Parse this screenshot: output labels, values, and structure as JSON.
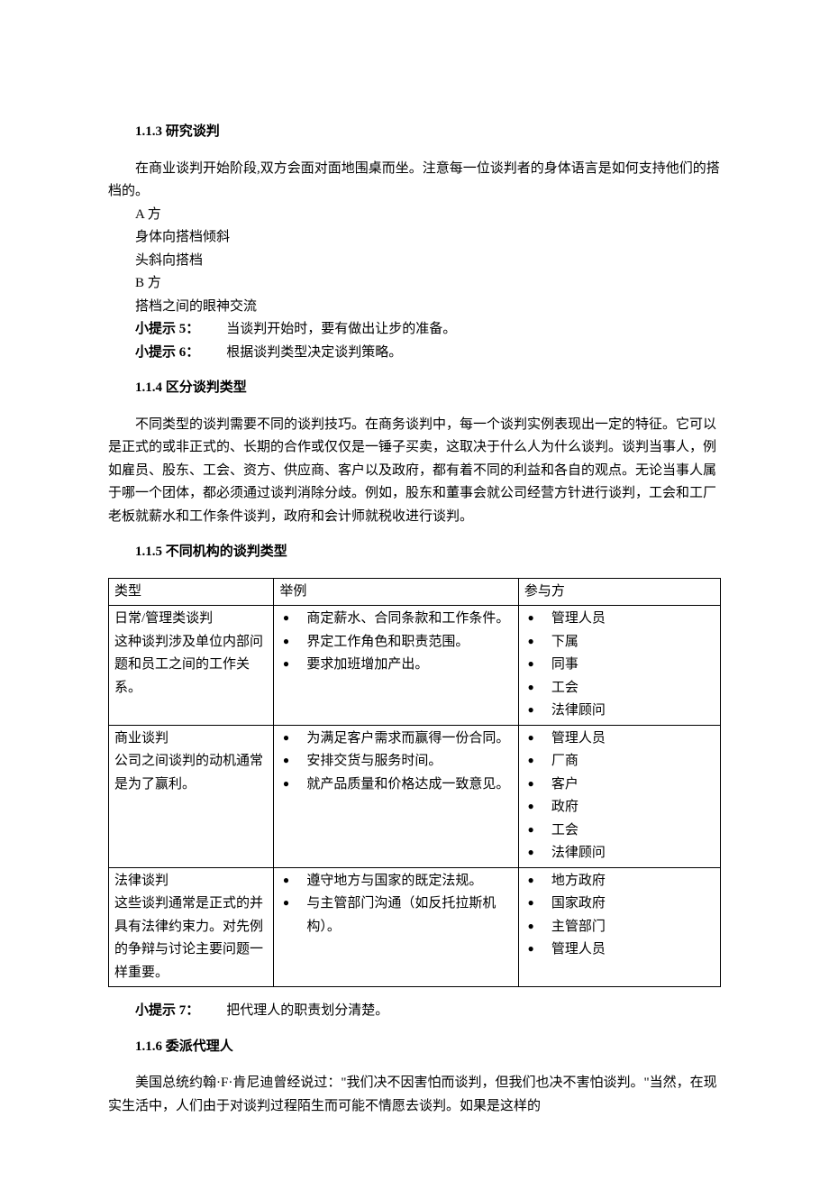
{
  "s113": {
    "heading": "1.1.3 研究谈判",
    "p1": "在商业谈判开始阶段,双方会面对面地围桌而坐。注意每一位谈判者的身体语言是如何支持他们的搭档的。",
    "lines": [
      "A 方",
      "身体向搭档倾斜",
      "头斜向搭档",
      "B 方",
      "搭档之间的眼神交流"
    ],
    "tip5_label": "小提示 5：",
    "tip5_text": "当谈判开始时，要有做出让步的准备。",
    "tip6_label": "小提示 6：",
    "tip6_text": "根据谈判类型决定谈判策略。"
  },
  "s114": {
    "heading": "1.1.4 区分谈判类型",
    "p1": "不同类型的谈判需要不同的谈判技巧。在商务谈判中，每一个谈判实例表现出一定的特征。它可以是正式的或非正式的、长期的合作或仅仅是一锤子买卖，这取决于什么人为什么谈判。谈判当事人，例如雇员、股东、工会、资方、供应商、客户以及政府，都有着不同的利益和各自的观点。无论当事人属于哪一个团体，都必须通过谈判消除分歧。例如，股东和董事会就公司经营方针进行谈判，工会和工厂老板就薪水和工作条件谈判，政府和会计师就税收进行谈判。"
  },
  "s115": {
    "heading": "1.1.5 不同机构的谈判类型",
    "headers": [
      "类型",
      "举例",
      "参与方"
    ],
    "rows": [
      {
        "type": "日常/管理类谈判\n这种谈判涉及单位内部问题和员工之间的工作关系。",
        "examples": [
          "商定薪水、合同条款和工作条件。",
          "界定工作角色和职责范围。",
          "要求加班增加产出。"
        ],
        "parties": [
          "管理人员",
          "下属",
          "同事",
          "工会",
          "法律顾问"
        ]
      },
      {
        "type": "商业谈判\n公司之间谈判的动机通常是为了赢利。",
        "examples": [
          "为满足客户需求而赢得一份合同。",
          "安排交货与服务时间。",
          "就产品质量和价格达成一致意见。"
        ],
        "parties": [
          "管理人员",
          "厂商",
          "客户",
          "政府",
          "工会",
          "法律顾问"
        ]
      },
      {
        "type": "法律谈判\n这些谈判通常是正式的并具有法律约束力。对先例的争辩与讨论主要问题一样重要。",
        "examples": [
          "遵守地方与国家的既定法规。",
          "与主管部门沟通（如反托拉斯机构）。"
        ],
        "parties": [
          "地方政府",
          "国家政府",
          "主管部门",
          "管理人员"
        ]
      }
    ],
    "tip7_label": "小提示 7：",
    "tip7_text": "把代理人的职责划分清楚。"
  },
  "s116": {
    "heading": "1.1.6 委派代理人",
    "p1": "美国总统约翰·F·肯尼迪曾经说过：\"我们决不因害怕而谈判，但我们也决不害怕谈判。\"当然，在现实生活中，人们由于对谈判过程陌生而可能不情愿去谈判。如果是这样的"
  }
}
